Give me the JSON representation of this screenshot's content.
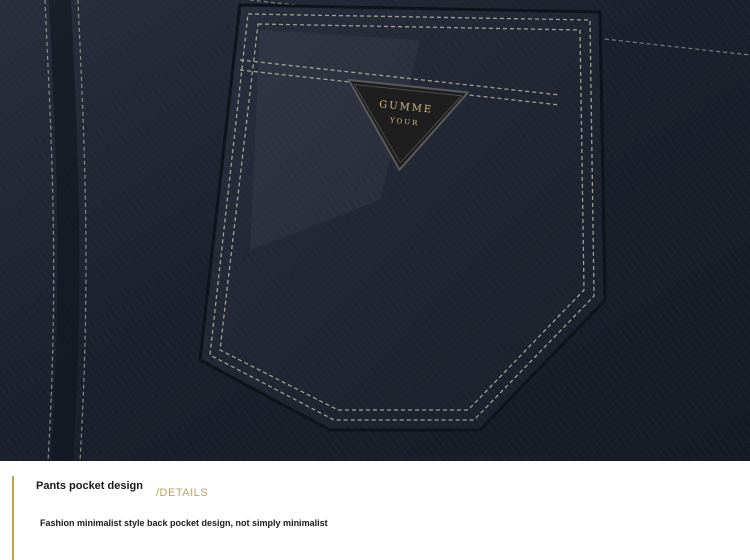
{
  "photo": {
    "badge_line1": "GUMME",
    "badge_line2": "YOUR"
  },
  "caption": {
    "title": "Pants pocket design",
    "tag": "/DETAILS",
    "description": "Fashion minimalist style back pocket design, not simply minimalist"
  },
  "colors": {
    "denim": "#1a1f2b",
    "stitch": "#b8b3a6",
    "accent_gold": "#c9a14a",
    "badge_black": "#1e1e1e"
  }
}
